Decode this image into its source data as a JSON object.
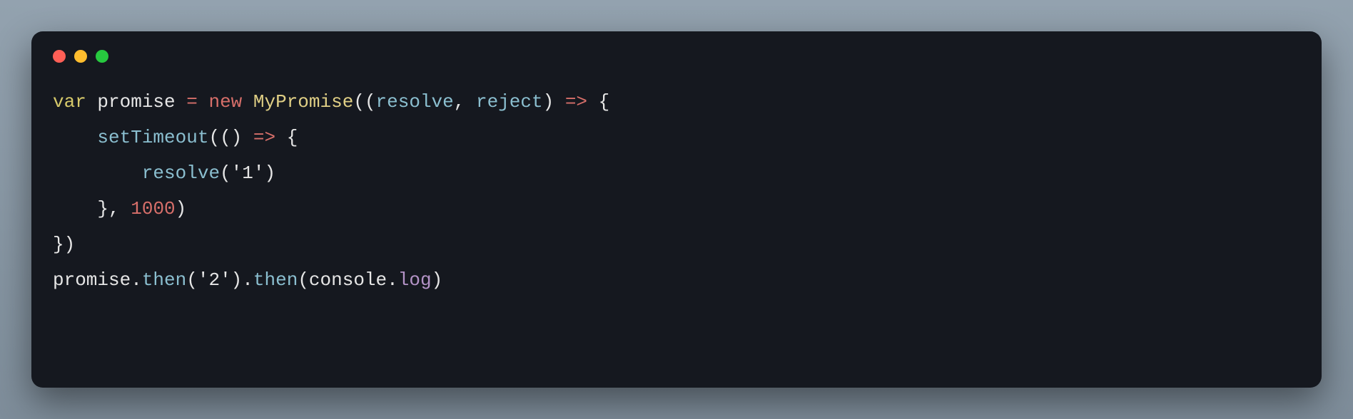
{
  "colors": {
    "background_page": "#8a99a6",
    "window_bg": "#15181f",
    "traffic_red": "#ff5f56",
    "traffic_yellow": "#ffbd2e",
    "traffic_green": "#27c93f",
    "kw": "#d6c96a",
    "op_new_arrow_num": "#d76f6a",
    "class": "#e0cf85",
    "fn_param": "#8bbfd0",
    "prop": "#b493c7",
    "default_text": "#e6e6e6"
  },
  "code": {
    "t_var": "var",
    "sp": " ",
    "id_promise": "promise",
    "t_eq": "=",
    "t_new": "new",
    "cls_MyPromise": "MyPromise",
    "p_open": "(",
    "p_open2": "(",
    "id_resolve": "resolve",
    "comma_sp": ", ",
    "id_reject": "reject",
    "p_close": ")",
    "t_arrow": "=>",
    "brace_open": "{",
    "indent1": "    ",
    "fn_setTimeout": "setTimeout",
    "p_open3": "(",
    "p_open4": "(",
    "p_close2": ")",
    "t_arrow2": "=>",
    "brace_open2": "{",
    "indent2": "        ",
    "fn_resolve_call": "resolve",
    "p_open5": "(",
    "str_1": "'1'",
    "p_close3": ")",
    "brace_close": "}",
    "comma_sp2": ", ",
    "num_1000": "1000",
    "p_close4": ")",
    "brace_close2": "}",
    "p_close5": ")",
    "id_promise2": "promise",
    "dot": ".",
    "fn_then": "then",
    "p_open6": "(",
    "str_2": "'2'",
    "p_close6": ")",
    "dot2": ".",
    "fn_then2": "then",
    "p_open7": "(",
    "obj_console": "console",
    "dot3": ".",
    "prop_log": "log",
    "p_close7": ")"
  }
}
